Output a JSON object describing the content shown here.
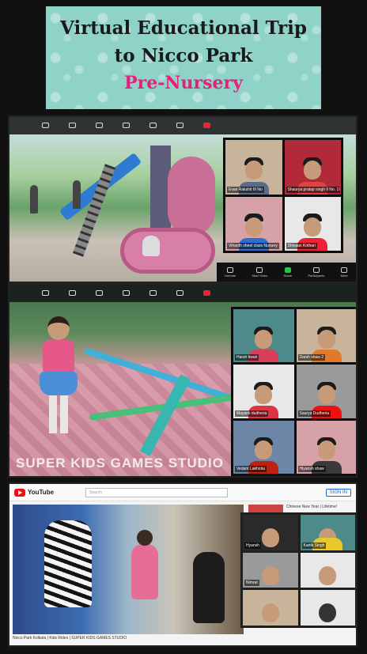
{
  "banner": {
    "line1": "Virtual Educational Trip",
    "line2": "to Nicco Park",
    "line3": "Pre-Nursery"
  },
  "panel1": {
    "gallery": [
      "Evan Rakshit III No",
      "Shaurya pratap singh Il No. 17",
      "Vihanth sheel class Nursery",
      "Shivaan Kothari"
    ],
    "controls": [
      "Unmute",
      "Start Video",
      "Share",
      "Participants",
      "More"
    ]
  },
  "panel2": {
    "watermark": "SUPER KIDS GAMES STUDIO",
    "gallery": [
      "Harsh tiwari",
      "Darsh shaw 2",
      "Mayank dudheria",
      "Saurya Dudheria",
      "Vedant Lakhotia",
      "Hiyansh shaw"
    ]
  },
  "panel3": {
    "logo": "YouTube",
    "search_placeholder": "Search",
    "signin": "SIGN IN",
    "video_title": "Nicco Park Kolkata | Kids Rides | SUPER KIDS GAMES STUDIO",
    "side_items": [
      "Chinese New Year | Lifetime!",
      "Funny Playtime Shows and"
    ],
    "gallery": [
      "Hyansh",
      "Kartik Singh",
      "Nimrat",
      "",
      "",
      ""
    ]
  },
  "colors": {
    "banner_bg": "#8fd3c8",
    "accent_pink": "#e0227a"
  }
}
